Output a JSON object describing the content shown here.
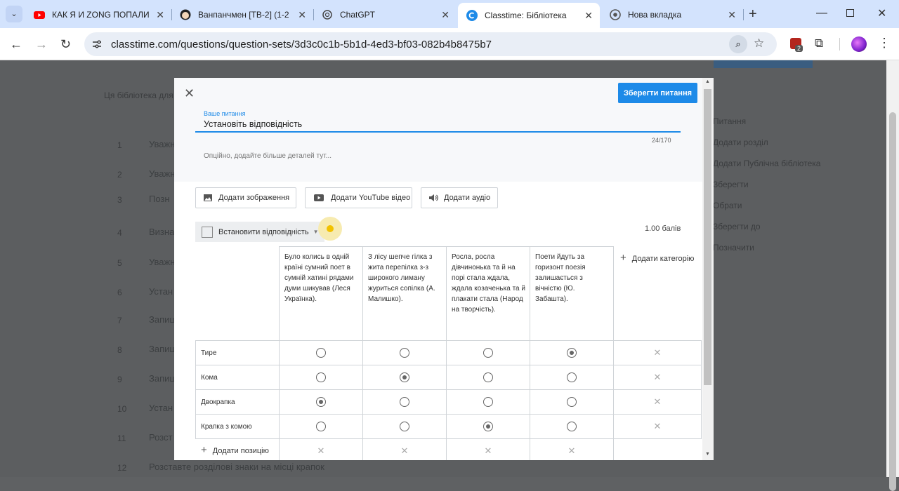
{
  "browser": {
    "tabs": [
      {
        "title": "КАК Я И ZONG ПОПАЛИ",
        "icon": "youtube-icon"
      },
      {
        "title": "Ванпанчмен [ТВ-2] (1-2",
        "icon": "anime-icon"
      },
      {
        "title": "ChatGPT",
        "icon": "chatgpt-icon"
      },
      {
        "title": "Classtime: Бібліотека",
        "icon": "classtime-icon"
      },
      {
        "title": "Нова вкладка",
        "icon": "chrome-icon"
      }
    ],
    "url": "classtime.com/questions/question-sets/3d3c0c1b-5b1d-4ed3-bf03-082b4b8475b7",
    "extension_badge": "2"
  },
  "background": {
    "row_numbers": [
      "1",
      "2",
      "3",
      "4",
      "5",
      "6",
      "7",
      "8",
      "9",
      "10",
      "11",
      "12"
    ],
    "row_texts": [
      "Уважн",
      "Уважн",
      "Позн",
      "Визна",
      "Уважн",
      "Устан",
      "Запиш",
      "Запиш",
      "Запиш",
      "Устан",
      "Розст",
      "Розставте розділові знаки на місці крапок"
    ],
    "right_texts": [
      "Питання",
      "Додати розділ",
      "Додати Публічна бібліотека",
      "Зберегти",
      "Обрати",
      "Зберегти до",
      "Позначити"
    ],
    "header_text": "Ця бібліотека для"
  },
  "modal": {
    "save_button": "Зберегти питання",
    "question_label": "Ваше питання",
    "question_value": "Установіть відповідність",
    "char_count": "24/170",
    "details_placeholder": "Опційно, додайте більше деталей тут...",
    "add_image": "Додати зображення",
    "add_youtube": "Додати YouTube відео",
    "add_audio": "Додати аудіо",
    "question_type": "Встановити відповідність",
    "points": "1.00 балів",
    "add_category": "Додати категорію",
    "add_position": "Додати позицію",
    "categories": [
      "Було колись в одній країні сумний поет в сумній хатині рядами думи шикував (Леся Українка).",
      "З лісу шепче гілка з жита перепілка з-з широкого лиману журиться сопілка (А. Малишко).",
      "Росла, росла дівчинонька та й на порі стала ждала, ждала козаченька та й плакати стала (Народ на творчість).",
      "Поети йдуть за горизонт поезія залишається з вічністю (Ю. Забашта)."
    ],
    "rows": [
      {
        "label": "Тире",
        "selected": 3
      },
      {
        "label": "Кома",
        "selected": 1
      },
      {
        "label": "Двокрапка",
        "selected": 0
      },
      {
        "label": "Крапка з комою",
        "selected": 2
      }
    ]
  }
}
